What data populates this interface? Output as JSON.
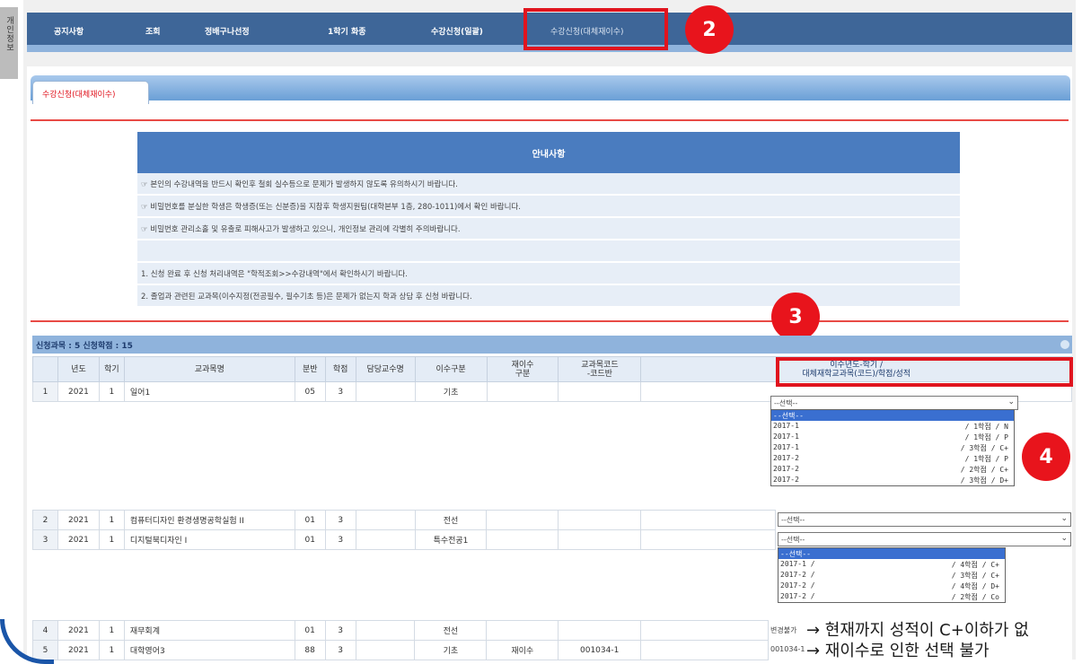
{
  "side_tab": {
    "label": "개인정보"
  },
  "topnav": {
    "items": [
      "공지사항",
      "조회",
      "정배구나선정",
      "1학기 화종",
      "수강신청(일괄)",
      "수강신청(대체재이수)"
    ]
  },
  "annotations": {
    "badge2": "2",
    "badge3": "3",
    "badge4": "4"
  },
  "tab": {
    "active_label": "수강신청(대체재이수)"
  },
  "notice": {
    "title": "안내사항",
    "lines": [
      "☞ 본인의 수강내역을 반드시 확인후 철회 실수등으로 문제가 발생하지 않도록 유의하시기 바랍니다.",
      "☞ 비밀번호를 분실한 학생은 학생증(또는 신분증)을 지참후 학생지원팀(대학본부 1층, 280-1011)에서 확인 바랍니다.",
      "☞ 비밀번호 관리소홀 및 유출로 피해사고가 발생하고 있으니, 개인정보 관리에 각별히 주의바랍니다.",
      "",
      "1. 신청 완료 후 신청 처리내역은 \"학적조회>>수강내역\"에서 확인하시기 바랍니다.",
      "2. 졸업과 관련된 교과목(이수지정(전공필수, 필수기초 등)은 문제가 없는지 학과 상담 후 신청 바랍니다."
    ]
  },
  "grid": {
    "summary": "신청과목 : 5 신청학점 : 15",
    "columns": [
      "년도",
      "학기",
      "교과목명",
      "분반",
      "학점",
      "담당교수명",
      "이수구분",
      "재이수\n구분",
      "교과목코드\n-코드반",
      "이수년도-학기 /\n대체재학교과목(코드)/학점/성적"
    ],
    "rows": [
      {
        "no": "1",
        "year": "2021",
        "term": "1",
        "course": "일어1",
        "sect": "05",
        "credit": "3",
        "prof": "",
        "type": "기초",
        "retake": "",
        "code": "",
        "choice": "--선택--"
      },
      {
        "no": "2",
        "year": "2021",
        "term": "1",
        "course": "컴퓨터디자인 환경생명공학실험 II",
        "sect": "01",
        "credit": "3",
        "prof": "",
        "type": "전선",
        "retake": "",
        "code": "",
        "choice": "--선택--"
      },
      {
        "no": "3",
        "year": "2021",
        "term": "1",
        "course": "디지털북디자인 I",
        "sect": "01",
        "credit": "3",
        "prof": "",
        "type": "특수전공1",
        "retake": "",
        "code": "",
        "choice": "--선택--"
      },
      {
        "no": "4",
        "year": "2021",
        "term": "1",
        "course": "재무회계",
        "sect": "01",
        "credit": "3",
        "prof": "",
        "type": "전선",
        "retake": "",
        "code": "",
        "choice": "변경불가"
      },
      {
        "no": "5",
        "year": "2021",
        "term": "1",
        "course": "대학영어3",
        "sect": "88",
        "credit": "3",
        "prof": "",
        "type": "기초",
        "retake": "재이수",
        "code": "001034-1",
        "choice": "001034-1"
      }
    ]
  },
  "dropdown1": {
    "options": [
      {
        "left": "--선택--",
        "right": ""
      },
      {
        "left": "2017-1",
        "right": "/ 1학점 / N"
      },
      {
        "left": "2017-1",
        "right": "/ 1학점 / P"
      },
      {
        "left": "2017-1",
        "right": "/ 3학점 / C+"
      },
      {
        "left": "2017-2",
        "right": "/ 1학점 / P"
      },
      {
        "left": "2017-2",
        "right": "/ 2학점 / C+"
      },
      {
        "left": "2017-2",
        "right": "/ 3학점 / D+"
      }
    ]
  },
  "dropdown3": {
    "options": [
      {
        "left": "--선택--",
        "right": ""
      },
      {
        "left": "2017-1 /",
        "right": "/ 4학점 / C+"
      },
      {
        "left": "2017-2 /",
        "right": "/ 3학점 / C+"
      },
      {
        "left": "2017-2 /",
        "right": "/ 4학점 / D+"
      },
      {
        "left": "2017-2 /",
        "right": "/ 2학점 / Co"
      }
    ]
  },
  "callouts": {
    "row4": "→ 현재까지 성적이 C+이하가 없",
    "row5": "→ 재이수로 인한 선택 불가"
  }
}
